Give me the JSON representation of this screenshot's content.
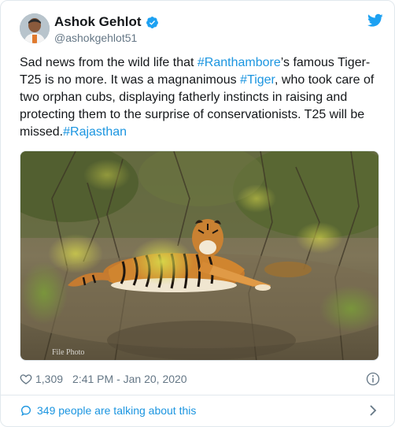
{
  "author": {
    "display_name": "Ashok Gehlot",
    "handle": "@ashokgehlot51",
    "verified": true
  },
  "tweet": {
    "segments": [
      {
        "text": "Sad news from the wild life that ",
        "type": "text"
      },
      {
        "text": "#Ranthambore",
        "type": "hashtag"
      },
      {
        "text": "’s famous Tiger-T25 is no more. It was a magnanimous ",
        "type": "text"
      },
      {
        "text": "#Tiger",
        "type": "hashtag"
      },
      {
        "text": ", who took care of two orphan cubs, displaying fatherly instincts in raising and protecting them to the surprise of conservationists. T25 will be missed.",
        "type": "text"
      },
      {
        "text": "#Rajasthan",
        "type": "hashtag"
      }
    ]
  },
  "media": {
    "watermark": "File Photo",
    "subject": "tiger resting in forest"
  },
  "meta": {
    "like_count": "1,309",
    "timestamp": "2:41 PM - Jan 20, 2020"
  },
  "footer": {
    "talking_text": "349 people are talking about this"
  },
  "icons": {
    "logo": "twitter-bird-icon",
    "verified": "verified-badge-icon",
    "like": "heart-icon",
    "info": "info-icon",
    "talking": "speech-bubble-icon",
    "chevron": "chevron-right-icon"
  },
  "colors": {
    "link": "#1b95e0",
    "text": "#14171a",
    "muted": "#657786",
    "border": "#e1e8ed"
  }
}
